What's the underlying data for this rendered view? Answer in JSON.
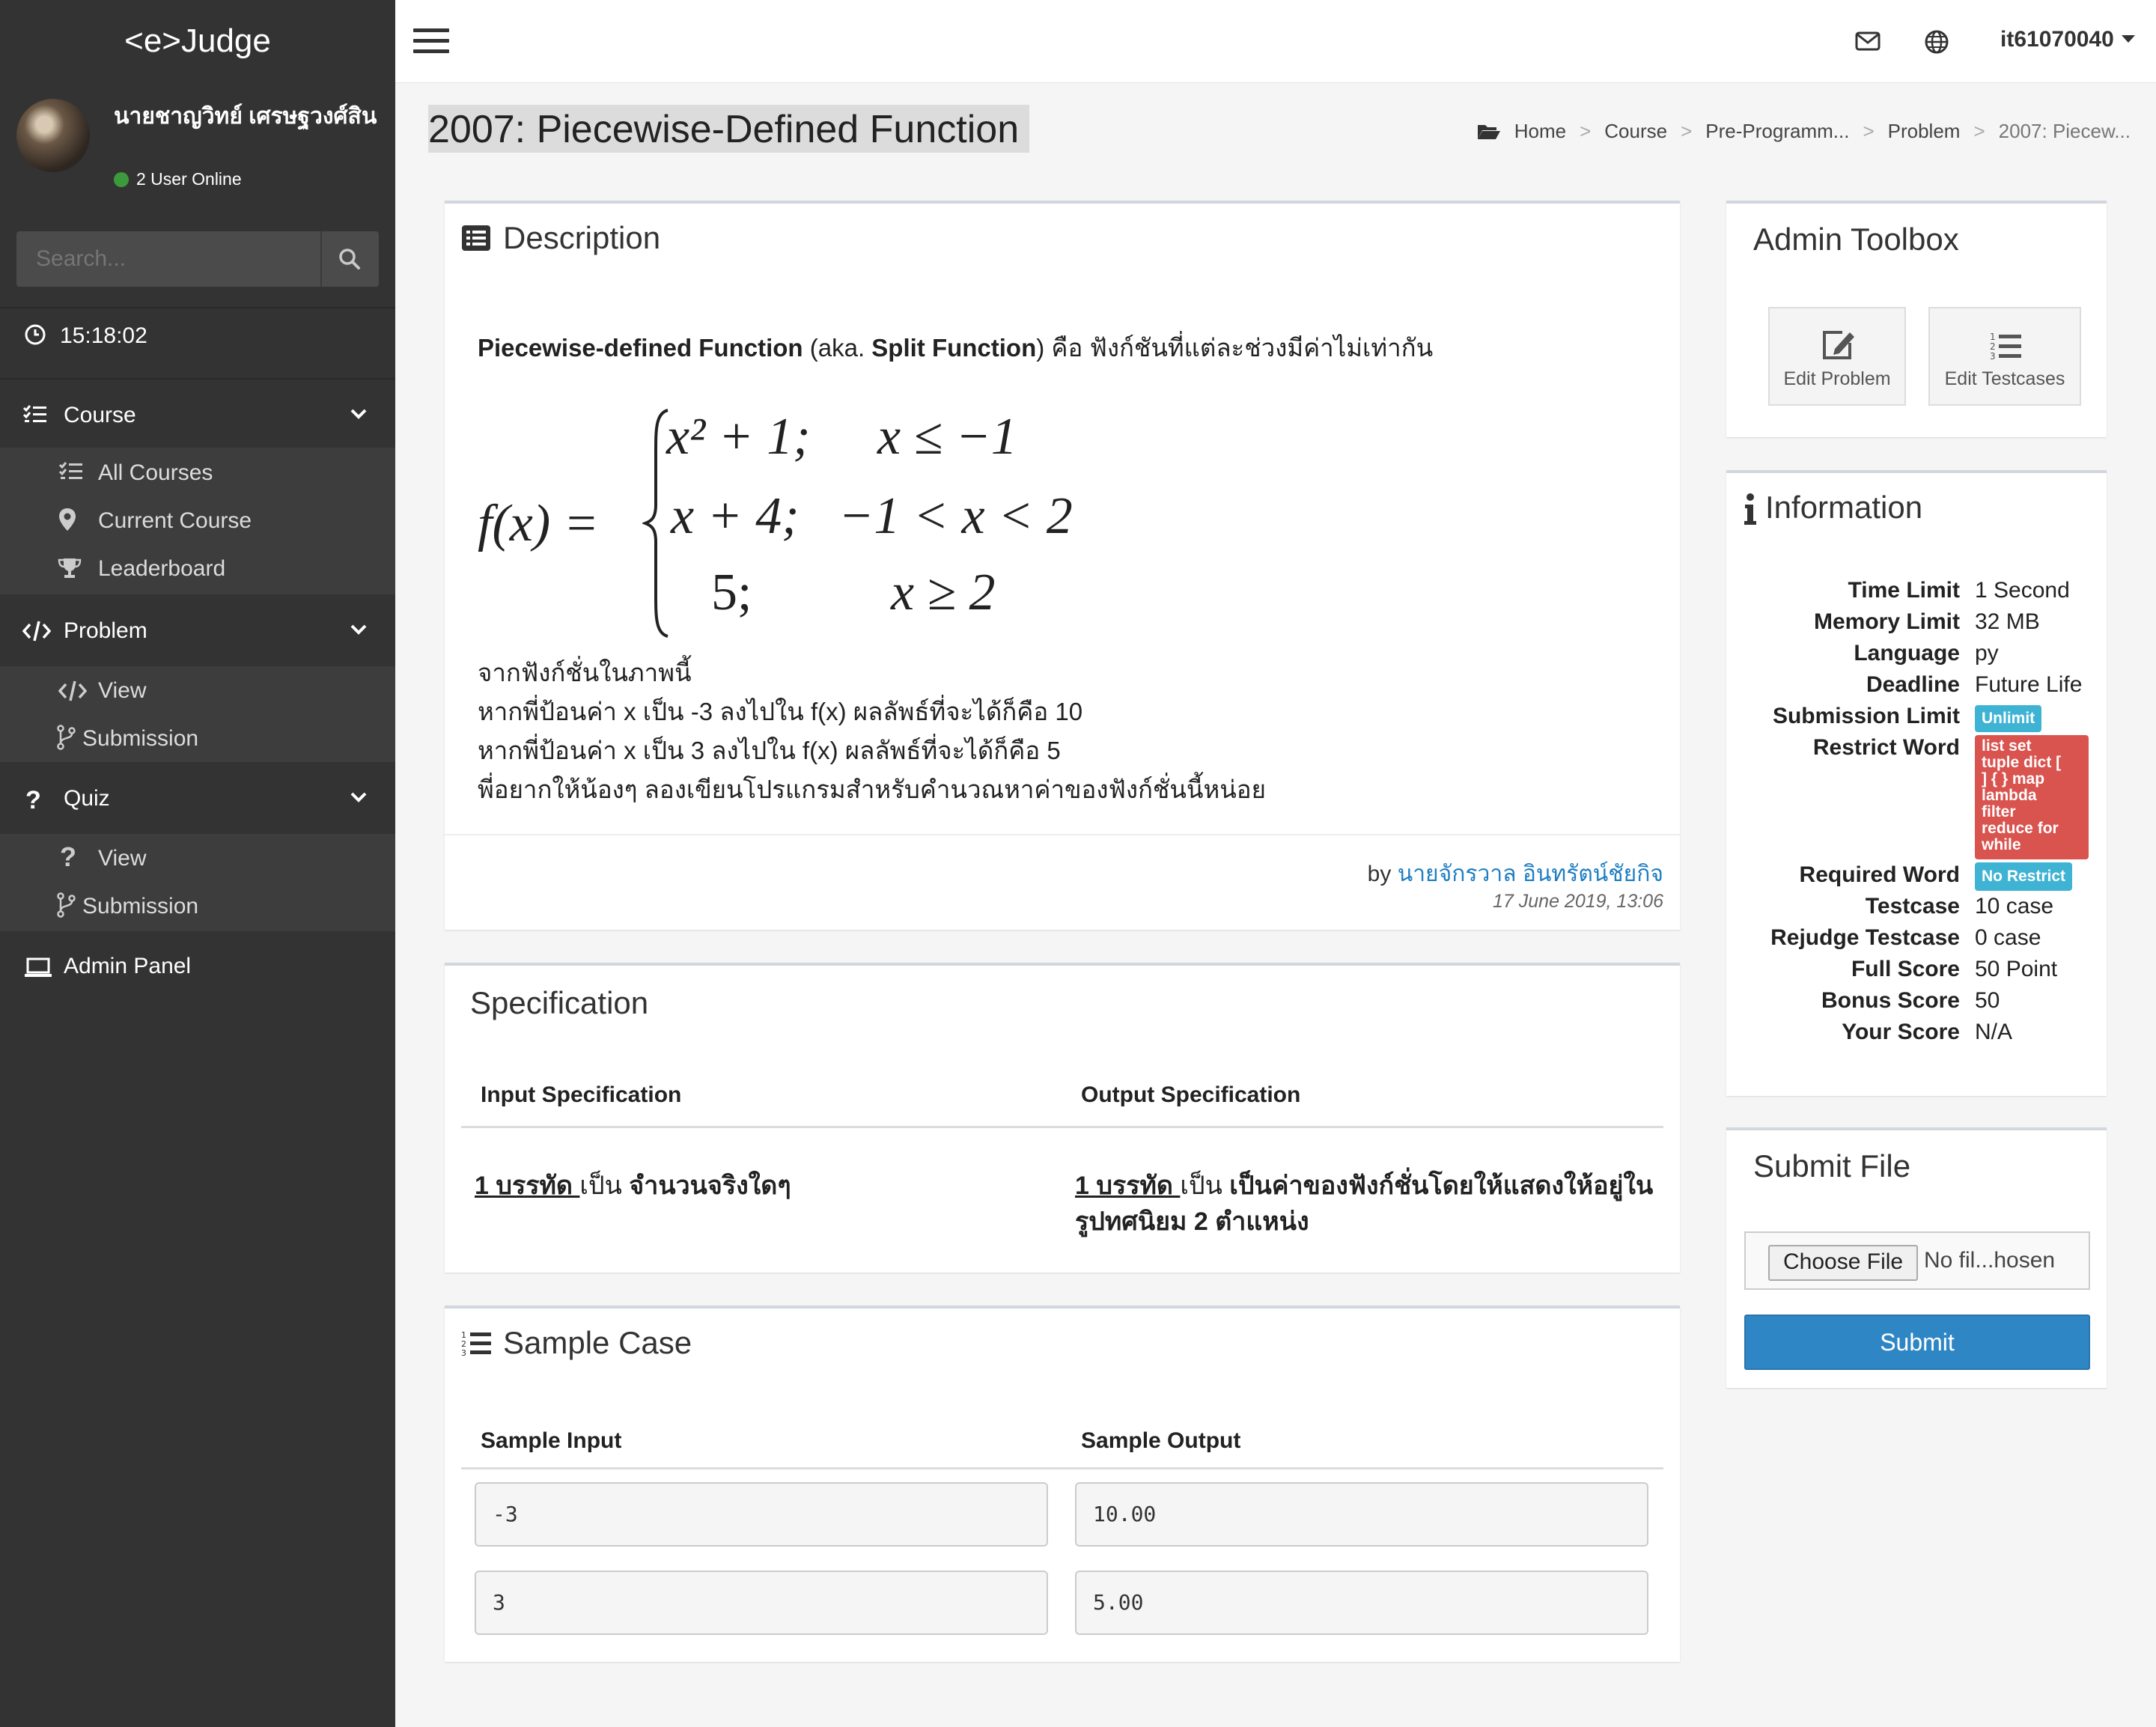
{
  "brand": "<e>Judge",
  "user": {
    "name": "นายชาญวิทย์ เศรษฐวงศ์สิน",
    "online": "2 User Online"
  },
  "search": {
    "placeholder": "Search..."
  },
  "clock": "15:18:02",
  "nav": {
    "course": {
      "label": "Course",
      "items": [
        "All Courses",
        "Current Course",
        "Leaderboard"
      ]
    },
    "problem": {
      "label": "Problem",
      "items": [
        "View",
        "Submission"
      ]
    },
    "quiz": {
      "label": "Quiz",
      "items": [
        "View",
        "Submission"
      ]
    },
    "admin": "Admin Panel"
  },
  "topbar": {
    "username": "it61070040",
    "icons": [
      "menu-icon",
      "envelope-icon",
      "globe-icon"
    ]
  },
  "page_title": "2007: Piecewise-Defined Function",
  "breadcrumb": [
    "Home",
    "Course",
    "Pre-Programm...",
    "Problem",
    "2007: Piecew..."
  ],
  "description": {
    "title": "Description",
    "intro_bold1": "Piecewise-defined Function",
    "intro_mid": " (aka. ",
    "intro_bold2": "Split Function",
    "intro_end": ")  คือ ฟังก์ชันที่แต่ละช่วงมีค่าไม่เท่ากัน",
    "formula": {
      "lhs": "f(x) =",
      "cases": [
        {
          "expr": "x² + 1;",
          "cond": "x ≤ −1"
        },
        {
          "expr": "x + 4;",
          "cond": "−1 < x < 2"
        },
        {
          "expr": "5;",
          "cond": "x ≥ 2"
        }
      ]
    },
    "lines": [
      "จากฟังก์ชั่นในภาพนี้",
      "หากพี่ป้อนค่า x เป็น -3 ลงไปใน f(x) ผลลัพธ์ที่จะได้ก็คือ 10",
      "หากพี่ป้อนค่า x เป็น 3 ลงไปใน f(x) ผลลัพธ์ที่จะได้ก็คือ 5",
      "พี่อยากให้น้องๆ ลองเขียนโปรแกรมสำหรับคำนวณหาค่าของฟังก์ชั่นนี้หน่อย"
    ],
    "by_prefix": "by",
    "author": "นายจักรวาล อินทรัตน์ชัยกิจ",
    "date": "17 June 2019, 13:06"
  },
  "specification": {
    "title": "Specification",
    "input_header": "Input Specification",
    "output_header": "Output Specification",
    "input_u": "1 บรรทัด ",
    "input_mid": "เป็น",
    "input_rest": " จำนวนจริงใดๆ",
    "output_u": "1 บรรทัด ",
    "output_mid": "เป็น",
    "output_rest": " เป็นค่าของฟังก์ชั่นโดยให้แสดงให้อยู่ในรูปทศนิยม 2 ตำแหน่ง"
  },
  "sample": {
    "title": "Sample Case",
    "input_header": "Sample Input",
    "output_header": "Sample Output",
    "rows": [
      {
        "input": "-3",
        "output": "10.00"
      },
      {
        "input": "3",
        "output": "5.00"
      }
    ]
  },
  "admin_toolbox": {
    "title": "Admin Toolbox",
    "edit_problem": "Edit Problem",
    "edit_testcases": "Edit Testcases"
  },
  "information": {
    "title": "Information",
    "time_limit": {
      "k": "Time Limit",
      "v": "1 Second"
    },
    "memory_limit": {
      "k": "Memory Limit",
      "v": "32 MB"
    },
    "language": {
      "k": "Language",
      "v": "py"
    },
    "deadline": {
      "k": "Deadline",
      "v": "Future Life"
    },
    "submission_limit": {
      "k": "Submission Limit",
      "v": "Unlimit"
    },
    "restrict_word": {
      "k": "Restrict Word",
      "v": [
        "list set",
        "tuple dict [",
        "] { } map",
        "lambda",
        "filter",
        "reduce for",
        "while"
      ]
    },
    "required_word": {
      "k": "Required Word",
      "v": "No Restrict"
    },
    "testcase": {
      "k": "Testcase",
      "v": "10 case"
    },
    "rejudge_testcase": {
      "k": "Rejudge Testcase",
      "v": "0 case"
    },
    "full_score": {
      "k": "Full Score",
      "v": "50 Point"
    },
    "bonus_score": {
      "k": "Bonus Score",
      "v": "50"
    },
    "your_score": {
      "k": "Your Score",
      "v": "N/A"
    }
  },
  "submit_file": {
    "title": "Submit File",
    "choose": "Choose File",
    "status": "No fil...hosen",
    "submit": "Submit"
  },
  "colors": {
    "sidebar": "#333333",
    "badge_info": "#3fb3d3",
    "badge_danger": "#d9534f",
    "primary": "#2f86c4"
  }
}
